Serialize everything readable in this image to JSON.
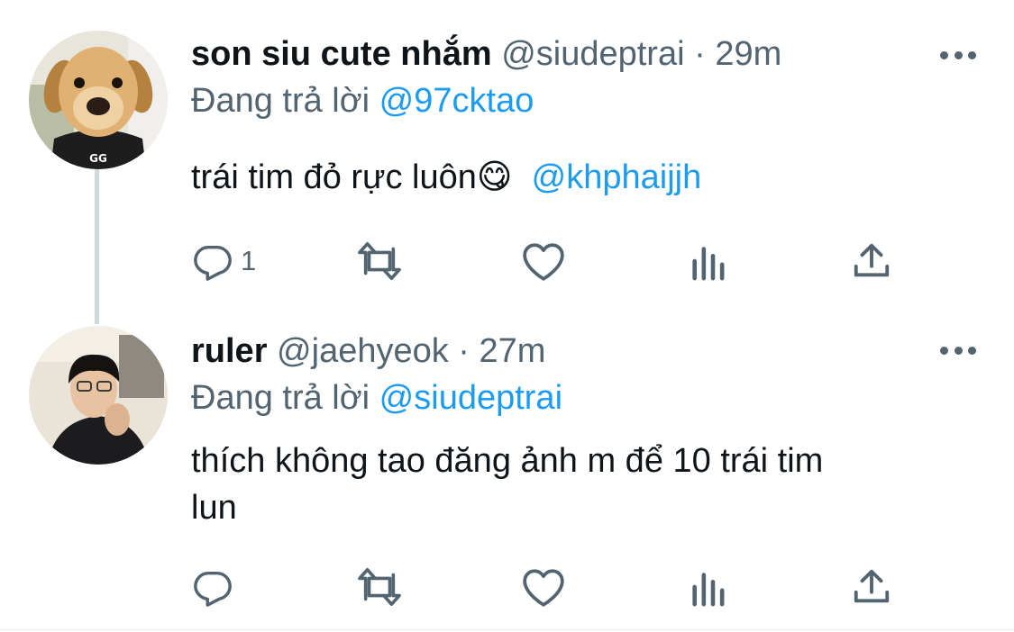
{
  "tweets": [
    {
      "name": "son siu cute nhắm",
      "handle": "@siudeptrai",
      "separator": "·",
      "time": "29m",
      "reply_prefix": "Đang trả lời",
      "reply_to": "@97cktao",
      "text": "trái tim đỏ rực luôn",
      "emoji": "😋",
      "text_mention": "@khphaijjh",
      "reply_count": "1",
      "avatar": "puppy-avatar"
    },
    {
      "name": "ruler",
      "handle": "@jaehyeok",
      "separator": "·",
      "time": "27m",
      "reply_prefix": "Đang trả lời",
      "reply_to": "@siudeptrai",
      "text_line1": "thích không tao đăng ảnh m để 10 trái tim",
      "text_line2": "lun",
      "reply_count": "",
      "avatar": "person-avatar"
    }
  ],
  "icons": {
    "reply": "reply-icon",
    "retweet": "retweet-icon",
    "like": "heart-icon",
    "analytics": "analytics-icon",
    "share": "share-icon",
    "more": "more-icon"
  },
  "colors": {
    "text": "#0f1419",
    "secondary": "#536471",
    "link": "#1d9bf0",
    "thread_line": "#cfd9de"
  }
}
